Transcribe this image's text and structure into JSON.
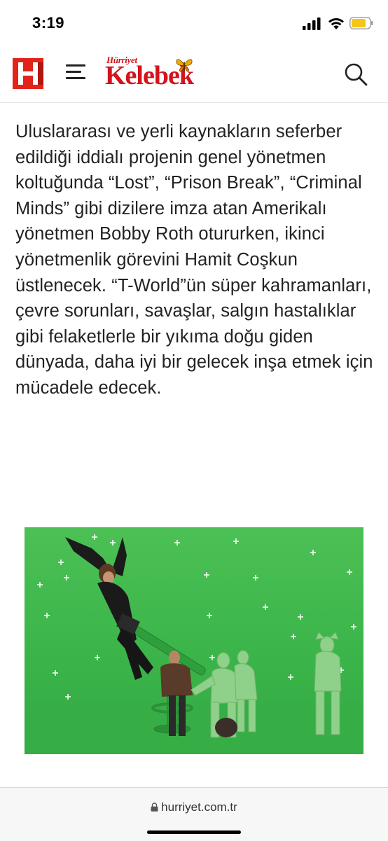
{
  "status_bar": {
    "time": "3:19",
    "icons": [
      "cellular-signal-icon",
      "wifi-icon",
      "battery-icon"
    ]
  },
  "header": {
    "logo_icon": "hurriyet-h-logo",
    "menu_icon": "hamburger-menu-icon",
    "brand_small": "Hürriyet",
    "brand_name": "Kelebek",
    "search_icon": "search-icon",
    "brand_color": "#d4131b",
    "logo_color": "#e2231a"
  },
  "article": {
    "paragraph": "Uluslararası ve yerli kaynakların seferber edildiği iddialı projenin genel yönetmen koltuğunda “Lost”, “Prison Break”, “Criminal Minds” gibi dizilere imza atan Amerikalı yönetmen Bobby Roth otururken, ikinci yönetmenlik görevini Hamit Coşkun üstlenecek. “T-World”ün süper kahramanları, çevre sorunları, savaşlar, salgın hastalıklar gibi felaketlerle bir yıkıma doğu giden dünyada, daha iyi bir gelecek inşa etmek için mücadele edecek."
  },
  "photo": {
    "description_icon": "green-screen-film-set-photo",
    "background_color": "#3bb54a"
  },
  "browser": {
    "url": "hurriyet.com.tr",
    "lock_icon": "lock-icon"
  }
}
